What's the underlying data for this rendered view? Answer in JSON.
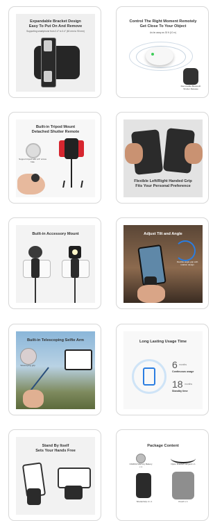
{
  "cards": [
    {
      "title": "Expandable Bracket Design\nEasy To Put On And Remove",
      "subtitle": "Supporting smartphone from 2.4\" to 3.4\" (60 mm to 90 mm)"
    },
    {
      "title": "Control The Right Moment Remotely\nGet Close To Your Object",
      "subtitle": "As far away as 30 ft (10 m)",
      "label": "Removable Bluetooth Shutter Release"
    },
    {
      "title": "Built-in Tripod Mount\nDetached Shutter Remote",
      "label": "Support tripod with 1/4\" screw hole"
    },
    {
      "title": "Flexible Left/Right Handed Grip\nFits Your Personal Preference"
    },
    {
      "title": "Built-in Accessory Mount"
    },
    {
      "title": "Adjust Tilt and Angle",
      "label": "Flexible angle grip with rotation design"
    },
    {
      "title": "Built-in Telescoping Selfie Arm",
      "label": "Telescoping grip"
    },
    {
      "title": "Long Lasting Usage Time",
      "usage_value": "6",
      "usage_unit": "months",
      "usage_label": "Continuous usage",
      "standby_value": "18",
      "standby_unit": "months",
      "standby_label": "Standby time"
    },
    {
      "title": "Stand By Itself\nSets Your Hands Free"
    },
    {
      "title": "Package Content",
      "items": [
        "CR2032 Mercury Battery x 1",
        "Nylon Braided Lanyard x 1",
        "ShutterGrip 2 x 1",
        "Pouch x 1"
      ]
    }
  ],
  "colors": {
    "grip": "#2b2b2b",
    "accent_blue": "#2a7de1",
    "phone_red": "#d6262f",
    "sky": "#8ab6d9"
  }
}
